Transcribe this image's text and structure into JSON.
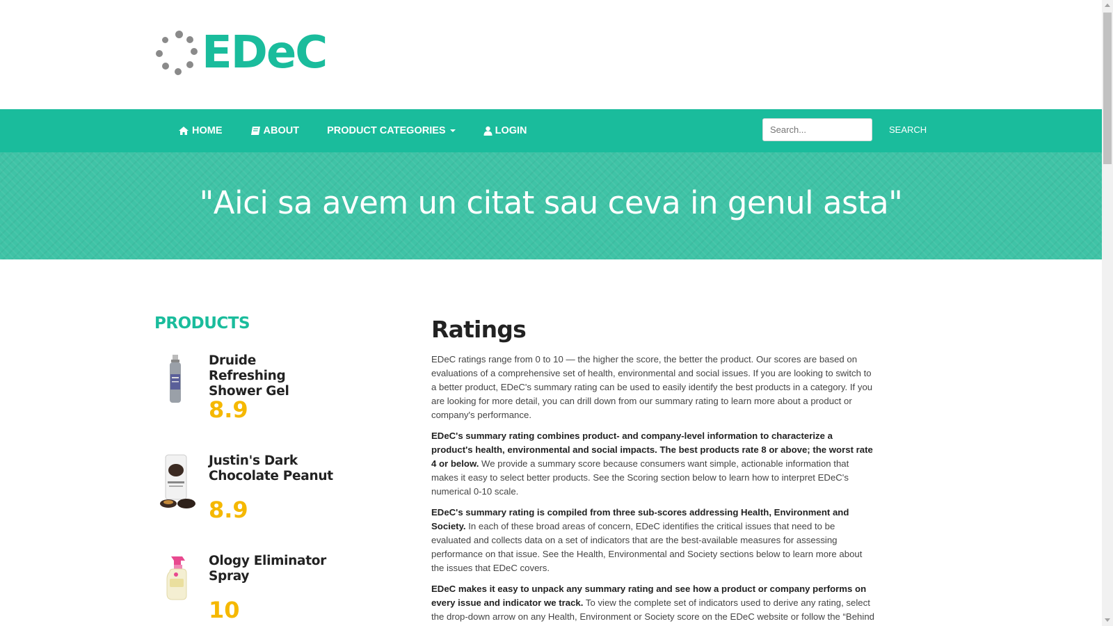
{
  "brand": {
    "name": "EDeC",
    "accent_color": "#1abc9c",
    "logo_icon": "dots-circle-logo"
  },
  "nav": {
    "items": [
      {
        "label": "HOME",
        "icon": "home-icon"
      },
      {
        "label": "ABOUT",
        "icon": "book-icon"
      },
      {
        "label": "PRODUCT CATEGORIES",
        "icon": "caret-down-icon"
      },
      {
        "label": "LOGIN",
        "icon": "user-icon"
      }
    ],
    "search_placeholder": "Search...",
    "search_label": "SEARCH"
  },
  "hero": {
    "quote": "\"Aici sa avem un citat sau ceva in genul asta\""
  },
  "sidebar": {
    "title": "PRODUCTS",
    "products": [
      {
        "name": "Druide Refreshing Shower Gel",
        "score": "8.9"
      },
      {
        "name": "Justin's Dark Chocolate Peanut",
        "score": "8.9"
      },
      {
        "name": "Ology Eliminator Spray",
        "score": "10"
      }
    ],
    "score_color": "#f5b800"
  },
  "main": {
    "title": "Ratings",
    "paragraphs": [
      {
        "bold": "",
        "text": "EDeC ratings range from 0 to 10 — the higher the score, the better the product. Our scores are based on evaluations of a comprehensive set of health, environmental and social issues. If you are looking to switch to a better product, EDeC's summary rating can be used to easily identify the best products in a category. If you are looking for more detail, you can drill down from our summary rating to learn more about a product or company's performance."
      },
      {
        "bold": "EDeC's summary rating combines product- and company-level information to characterize a product's health, environmental and social impacts. The best products rate 8 or above; the worst rate 4 or below.",
        "text": " We provide a summary score because consumers want simple, actionable information that makes it easy to select better products. See the Scoring section below to learn how to interpret EDeC's numerical 0-10 scale."
      },
      {
        "bold": "EDeC's summary rating is compiled from three sub-scores addressing Health, Environment and Society.",
        "text": " In each of these broad areas of concern, EDeC identifies the critical issues that need to be evaluated and collects data on a set of indicators that are the best-available measures for assessing performance on that issue. See the Health, Environmental and Society sections below to learn more about the issues that EDeC covers."
      },
      {
        "bold": "EDeC makes it easy to unpack any summary rating and see how a product or company performs on every issue and indicator we track.",
        "text": " To view the complete set of indicators used to derive any rating, select the drop-down arrow on any Health, Environment or Society score on the EDeC website or follow the “Behind the Ratings” link in our mobile applications."
      }
    ]
  }
}
